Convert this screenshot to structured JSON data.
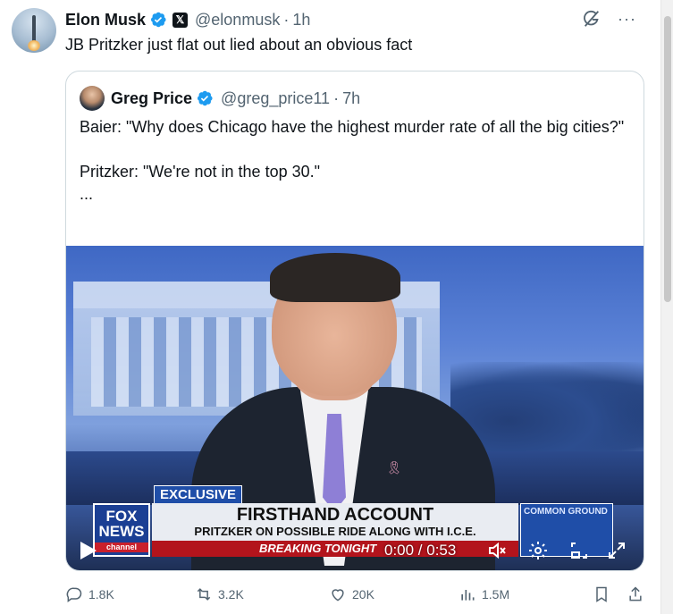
{
  "tweet": {
    "author_name": "Elon Musk",
    "author_handle": "@elonmusk",
    "separator": "·",
    "time": "1h",
    "x_badge": "𝕏",
    "text": "JB Pritzker just flat out lied about an obvious fact",
    "more": "···"
  },
  "quote": {
    "author_name": "Greg Price",
    "author_handle": "@greg_price11",
    "separator": "·",
    "time": "7h",
    "line1": "Baier: \"Why does Chicago have the highest murder rate of all the big cities?\"",
    "line2": "Pritzker: \"We're not in the top 30.\"",
    "ellipsis": "..."
  },
  "video": {
    "tag": "EXCLUSIVE",
    "chyron_title": "FIRSTHAND ACCOUNT",
    "chyron_sub": "PRITZKER ON POSSIBLE RIDE ALONG WITH I.C.E.",
    "breaking": "BREAKING TONIGHT",
    "logo_line1": "FOX",
    "logo_line2": "NEWS",
    "logo_channel": "channel",
    "side_panel": "COMMON GROUND",
    "time_readout": "0:00 / 0:53"
  },
  "actions": {
    "replies": "1.8K",
    "reposts": "3.2K",
    "likes": "20K",
    "views": "1.5M"
  },
  "colors": {
    "verified": "#1d9bf0",
    "muted": "#536471"
  },
  "icons": [
    "grok-icon",
    "more-icon",
    "verified-badge-icon",
    "reply-icon",
    "repost-icon",
    "like-icon",
    "views-icon",
    "bookmark-icon",
    "share-icon",
    "play-icon",
    "volume-icon",
    "settings-icon",
    "pip-icon",
    "fullscreen-icon"
  ]
}
